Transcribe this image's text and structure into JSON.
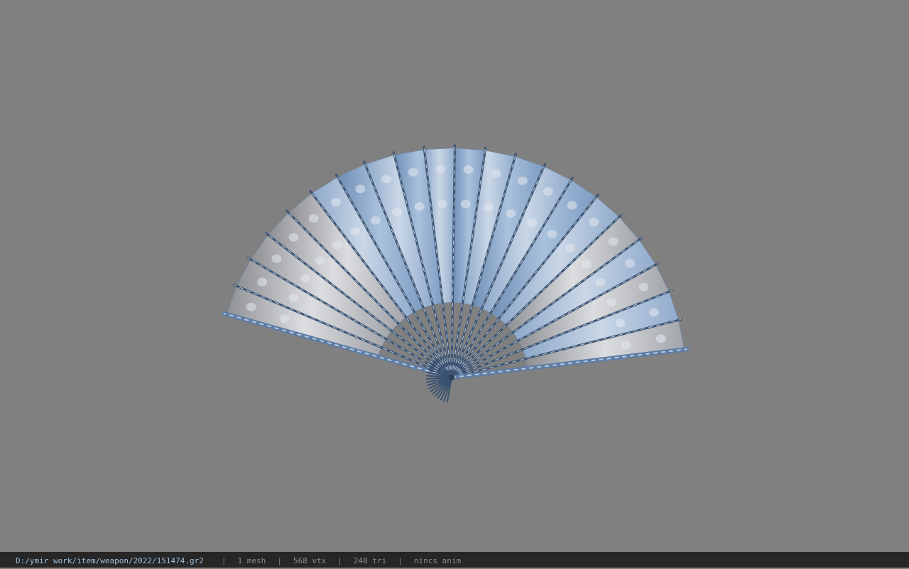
{
  "viewer": {
    "background_color": "#808080",
    "model": "folding-fan"
  },
  "status_bar": {
    "file_path": "D:/ymir work/item/weapon/2022/151474.gr2",
    "separator": "|",
    "mesh_count": "1 mesh",
    "vertex_count": "568 vtx",
    "triangle_count": "248 tri",
    "anim_status": "nincs anim"
  }
}
